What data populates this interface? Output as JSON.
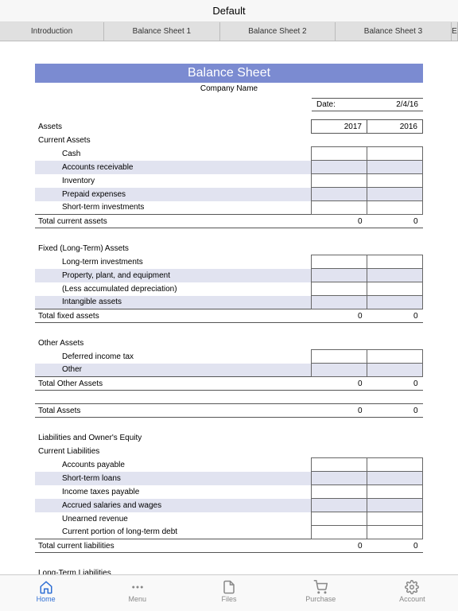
{
  "title": "Default",
  "tabs": [
    "Introduction",
    "Balance Sheet 1",
    "Balance Sheet 2",
    "Balance Sheet 3",
    "E"
  ],
  "sheet": {
    "banner": "Balance Sheet",
    "company": "Company Name",
    "datelabel": "Date:",
    "dateval": "2/4/16",
    "years": {
      "y1": "2017",
      "y2": "2016"
    },
    "sec1": "Assets",
    "sec1a": "Current Assets",
    "rows1": [
      "Cash",
      "Accounts receivable",
      "Inventory",
      "Prepaid expenses",
      "Short-term investments"
    ],
    "tot1": "Total current assets",
    "sec2": "Fixed (Long-Term) Assets",
    "rows2": [
      "Long-term investments",
      "Property, plant, and equipment",
      "(Less accumulated depreciation)",
      "Intangible assets"
    ],
    "tot2": "Total fixed assets",
    "sec3": "Other Assets",
    "rows3": [
      "Deferred income tax",
      "Other"
    ],
    "tot3": "Total Other Assets",
    "tot4": "Total Assets",
    "sec4": "Liabilities and Owner's Equity",
    "sec4a": "Current Liabilities",
    "rows4": [
      "Accounts payable",
      "Short-term loans",
      "Income taxes payable",
      "Accrued salaries and wages",
      "Unearned revenue",
      "Current portion of long-term debt"
    ],
    "tot5": "Total current liabilities",
    "sec5": "Long-Term Liabilities",
    "zero": "0"
  },
  "nav": {
    "home": "Home",
    "menu": "Menu",
    "files": "Files",
    "purchase": "Purchase",
    "account": "Account"
  }
}
